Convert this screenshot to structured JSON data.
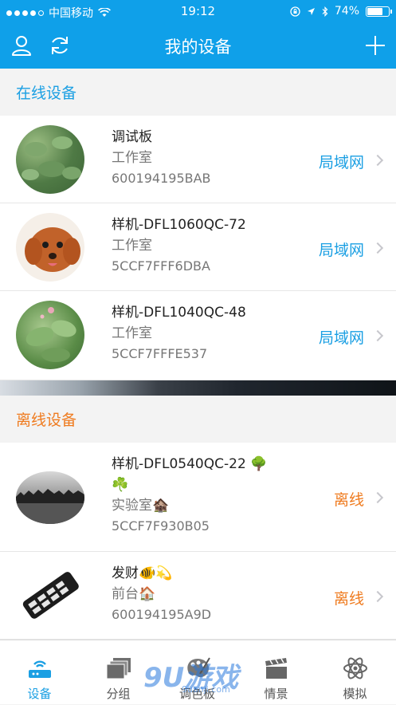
{
  "statusbar": {
    "carrier": "中国移动",
    "time": "19:12",
    "battery": "74%",
    "battery_level": 0.74
  },
  "navbar": {
    "title": "我的设备"
  },
  "online_section": {
    "title": "在线设备",
    "devices": [
      {
        "name": "调试板",
        "room": "工作室",
        "mac": "600194195BAB",
        "status": "局域网"
      },
      {
        "name": "样机-DFL1060QC-72",
        "room": "工作室",
        "mac": "5CCF7FFF6DBA",
        "status": "局域网"
      },
      {
        "name": "样机-DFL1040QC-48",
        "room": "工作室",
        "mac": "5CCF7FFFE537",
        "status": "局域网"
      }
    ]
  },
  "offline_section": {
    "title": "离线设备",
    "devices": [
      {
        "name": "样机-DFL0540QC-22 🌳",
        "name2": "☘️",
        "room": "实验室🏚️",
        "mac": "5CCF7F930B05",
        "status": "离线"
      },
      {
        "name": "发财🐠💫",
        "room": "前台🏠",
        "mac": "600194195A9D",
        "status": "离线"
      }
    ]
  },
  "tabbar": {
    "tabs": [
      {
        "label": "设备",
        "icon": "router-icon"
      },
      {
        "label": "分组",
        "icon": "stack-icon"
      },
      {
        "label": "调色板",
        "icon": "palette-icon"
      },
      {
        "label": "情景",
        "icon": "clapper-icon"
      },
      {
        "label": "模拟",
        "icon": "atom-icon"
      }
    ]
  },
  "watermark": {
    "text": "9U游戏",
    "subtext": "9uanji.com"
  },
  "colors": {
    "accent": "#0fa0e9",
    "lan": "#1a9fe3",
    "offline": "#ef7b1f"
  }
}
